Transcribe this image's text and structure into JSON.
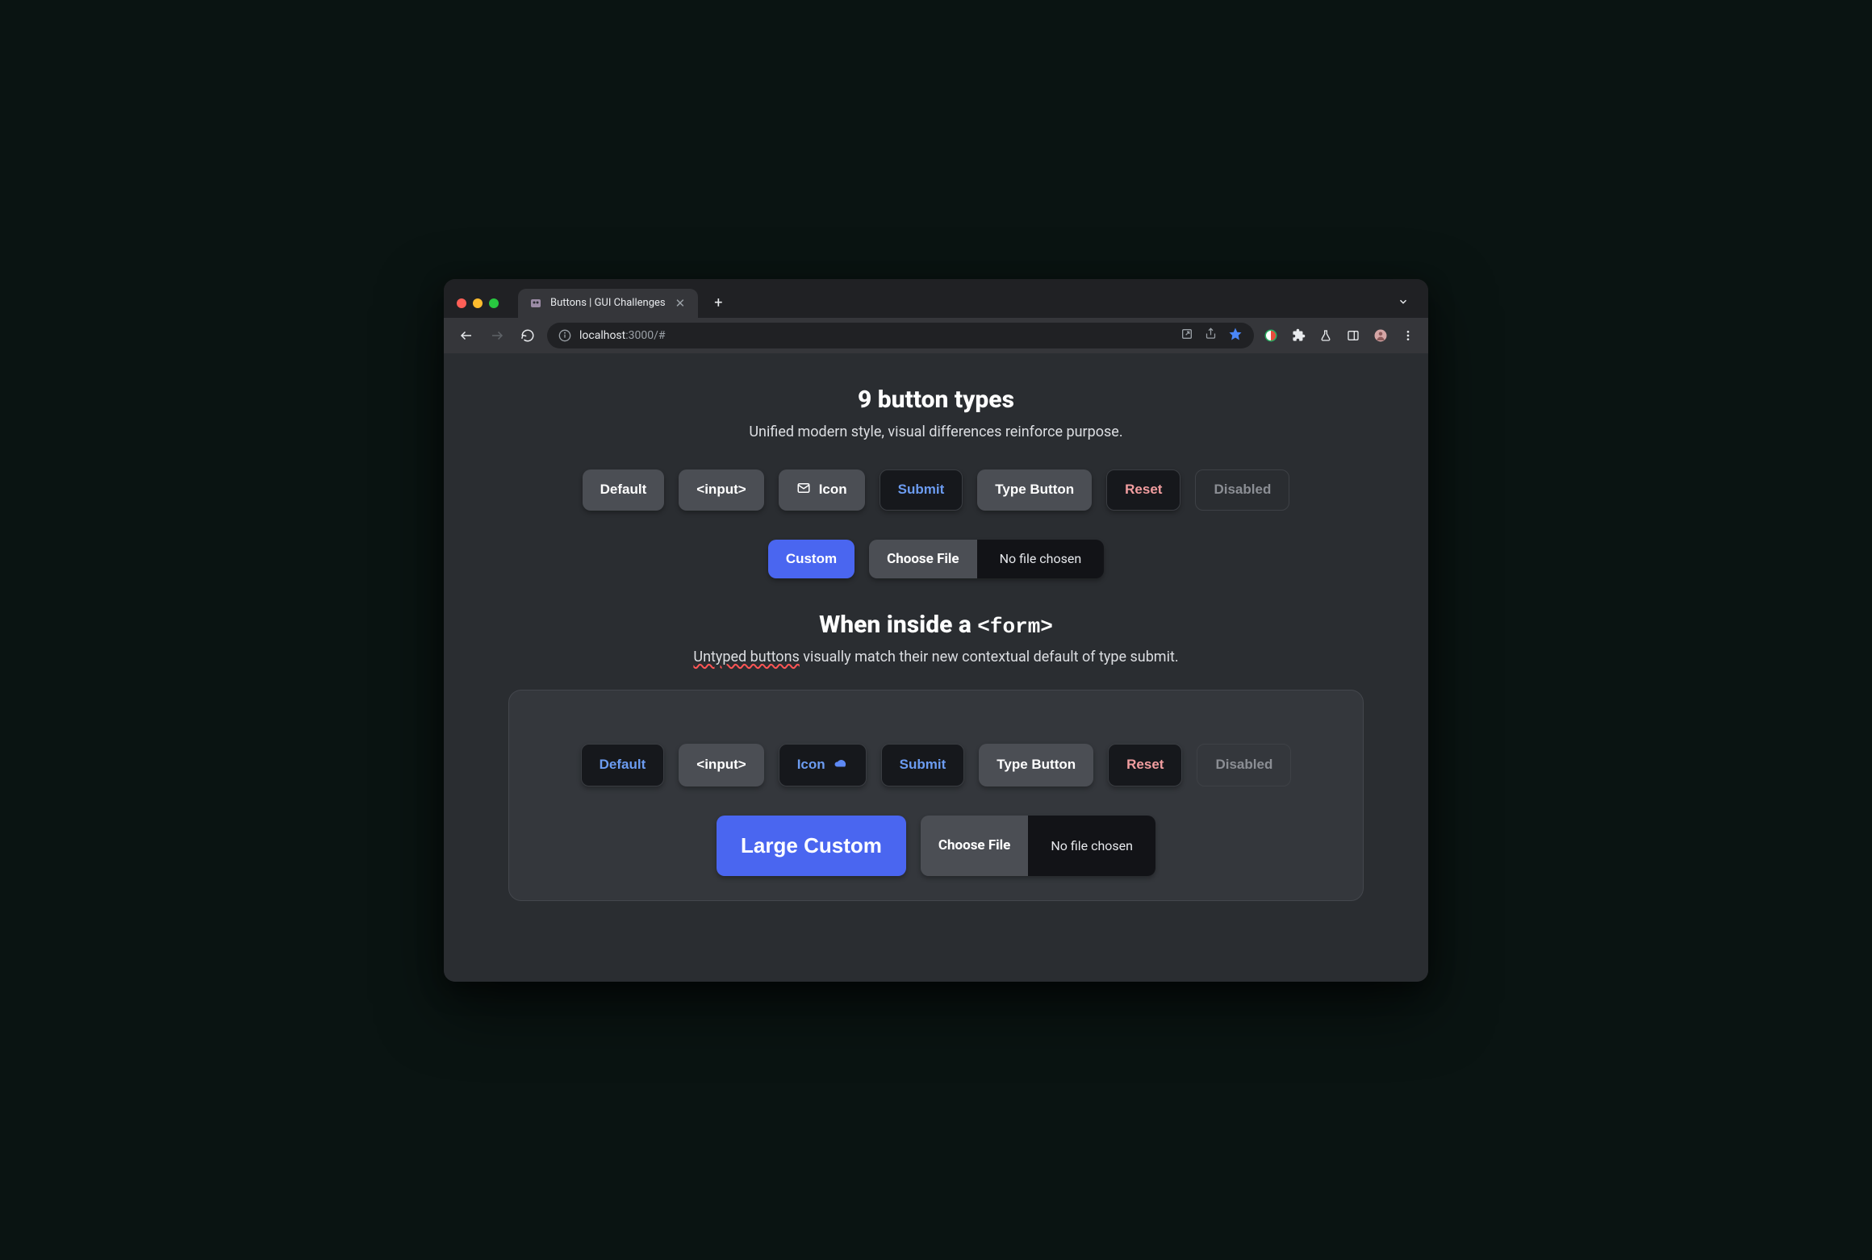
{
  "browser": {
    "tab_title": "Buttons | GUI Challenges",
    "url": {
      "host": "localhost",
      "port": ":3000",
      "path": "/#"
    }
  },
  "section1": {
    "heading": "9 button types",
    "subtitle": "Unified modern style, visual differences reinforce purpose.",
    "buttons": {
      "default": "Default",
      "input": "<input>",
      "icon": "Icon",
      "submit": "Submit",
      "type_button": "Type Button",
      "reset": "Reset",
      "disabled": "Disabled",
      "custom": "Custom",
      "choose_file": "Choose File",
      "file_status": "No file chosen"
    }
  },
  "section2": {
    "heading_prefix": "When inside a ",
    "heading_code": "<form>",
    "subtitle_prefix": "Untyped buttons",
    "subtitle_rest": " visually match their new contextual default of type submit.",
    "buttons": {
      "default": "Default",
      "input": "<input>",
      "icon": "Icon",
      "submit": "Submit",
      "type_button": "Type Button",
      "reset": "Reset",
      "disabled": "Disabled",
      "large_custom": "Large Custom",
      "choose_file": "Choose File",
      "file_status": "No file chosen"
    }
  }
}
